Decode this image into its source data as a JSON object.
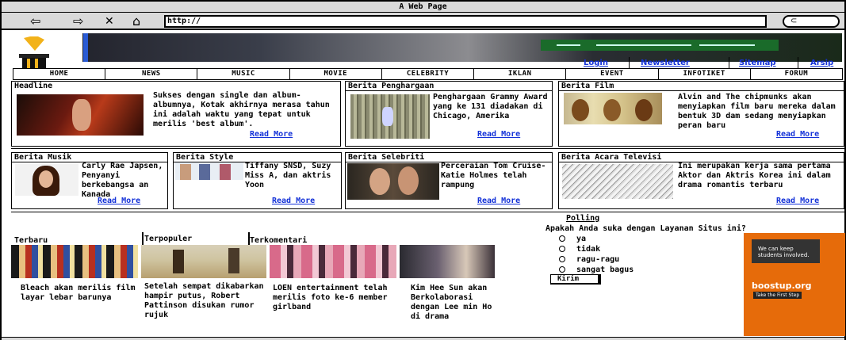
{
  "window": {
    "title": "A Web Page"
  },
  "browser": {
    "url": "http://",
    "back_icon": "back-arrow-icon",
    "forward_icon": "forward-arrow-icon",
    "close_icon": "close-icon",
    "home_icon": "home-icon",
    "search_icon": "search-icon"
  },
  "toplinks": [
    "Login",
    "Newsletter",
    "Sitemap",
    "Arsip"
  ],
  "nav": [
    "HOME",
    "NEWS",
    "MUSIC",
    "MOVIE",
    "CELEBRITY",
    "IKLAN",
    "EVENT",
    "INFOTIKET",
    "FORUM"
  ],
  "headline": {
    "title": "Headline",
    "text": "Sukses dengan single dan album-albumnya, Kotak akhirnya merasa tahun ini adalah waktu yang tepat untuk merilis 'best album'.",
    "more": "Read More"
  },
  "penghargaan": {
    "title": "Berita Penghargaan",
    "text": "Penghargaan Grammy Award yang ke 131 diadakan di Chicago, Amerika",
    "more": "Read More"
  },
  "film": {
    "title": "Berita Film",
    "text": "Alvin and The chipmunks akan menyiapkan film baru mereka dalam bentuk 3D dam sedang menyiapkan peran baru",
    "more": "Read More"
  },
  "musik": {
    "title": "Berita Musik",
    "text": "Carly Rae Japsen, Penyanyi berkebangsa an Kanada",
    "more": "Read More"
  },
  "style": {
    "title": "Berita Style",
    "text": "Tiffany SNSD, Suzy Miss A, dan aktris Yoon",
    "more": "Read More"
  },
  "selebriti": {
    "title": "Berita Selebriti",
    "text": "Perceraian Tom Cruise-Katie Holmes telah rampung",
    "more": "Read More"
  },
  "acara": {
    "title": "Berita Acara Televisi",
    "text": "Ini merupakan kerja sama pertama Aktor dan Aktris Korea ini dalam drama romantis terbaru",
    "more": "Read More"
  },
  "tabs": [
    "Terbaru",
    "Terpopuler",
    "Terkomentari"
  ],
  "lower_items": [
    "Bleach akan merilis film layar lebar barunya",
    "Setelah sempat dikabarkan hampir putus, Robert Pattinson disukan rumor rujuk",
    "LOEN entertainment telah merilis foto ke-6 member girlband",
    "Kim Hee Sun akan Berkolaborasi dengan Lee min Ho di drama"
  ],
  "polling": {
    "title": "Polling",
    "question": "Apakah Anda suka dengan Layanan Situs ini?",
    "options": [
      "ya",
      "tidak",
      "ragu-ragu",
      "sangat bagus"
    ],
    "submit": "Kirim"
  },
  "ad": {
    "line1": "We can keep students involved.",
    "brand": "boostup.org",
    "cta": "Take the First Step"
  }
}
